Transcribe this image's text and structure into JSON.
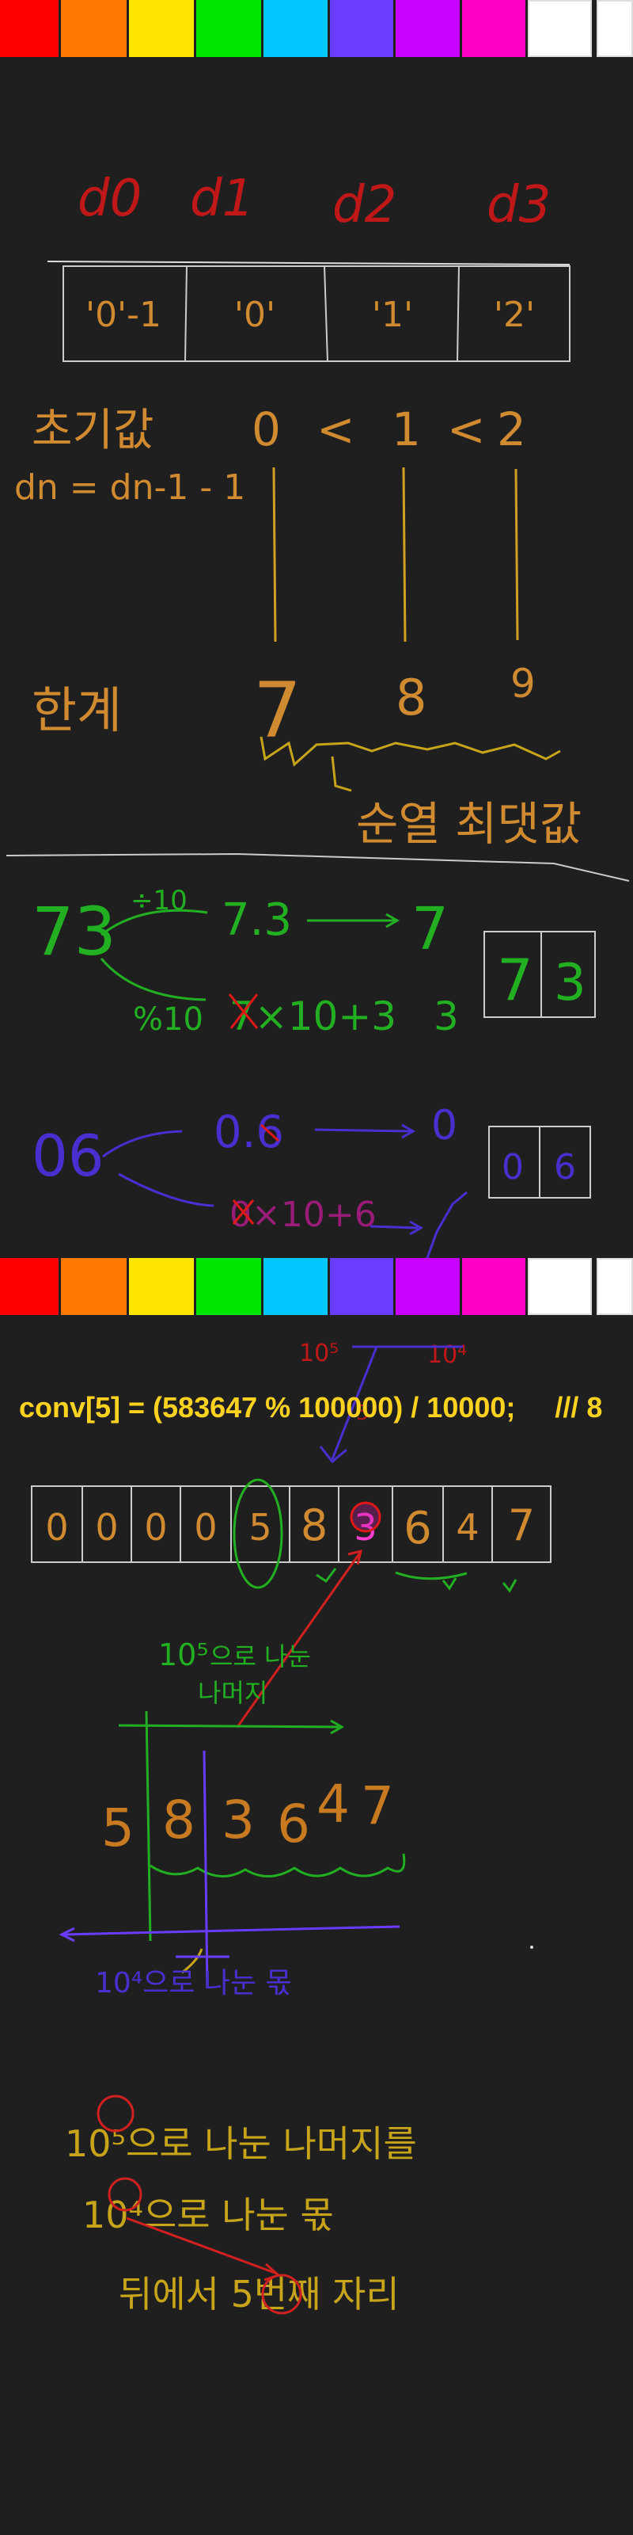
{
  "palette": {
    "colors": [
      "#ff0000",
      "#ff7a00",
      "#ffe600",
      "#00e600",
      "#00c8ff",
      "#6a3cff",
      "#c800ff",
      "#ff00c8",
      "#ffffff",
      "#ffffff"
    ]
  },
  "section1": {
    "var_labels": [
      "d0",
      "d1",
      "d2",
      "d3"
    ],
    "boxes": [
      "'0'-1",
      "'0'",
      "'1'",
      "'2'"
    ],
    "init_label": "초기값",
    "init_order": [
      "0",
      "<",
      "1",
      "<",
      "2"
    ],
    "formula": "dn = dn-1 - 1",
    "limit_label": "한계",
    "limits": [
      "7",
      "8",
      "9"
    ],
    "loop_label": "순열 최댓값"
  },
  "section2": {
    "number": "73",
    "div_label": "÷10",
    "div_result": "7.3",
    "arrow_result": "7",
    "mod_label": "%10",
    "mod_expr": "7×10+3",
    "mod_result": "3",
    "boxes": [
      "7",
      "3"
    ]
  },
  "section3": {
    "number": "06",
    "div_result": "0.6",
    "arrow_result": "0",
    "mod_expr": "0×10+6",
    "boxes": [
      "0",
      "6"
    ]
  },
  "section4": {
    "code": "conv[5] = (583647 % 100000) / 10000;     /// 8",
    "pow_left": "10⁵",
    "pow_right": "10⁴",
    "mark": "5",
    "digits": [
      "0",
      "0",
      "0",
      "0",
      "5",
      "8",
      "3",
      "6",
      "4",
      "7"
    ],
    "rem_note_pow": "10⁵",
    "rem_note_a": "으로 나눈",
    "rem_note_b": "나머지",
    "number_digits": [
      "5",
      "8",
      "3",
      "6",
      "4",
      "7"
    ],
    "quot_note": "10⁴으로 나눈 몫",
    "summary_line1": "10⁵으로 나눈 나머지를",
    "summary_line2": "10⁴으로 나눈 몫",
    "summary_line3": "뒤에서 5번째 자리"
  }
}
